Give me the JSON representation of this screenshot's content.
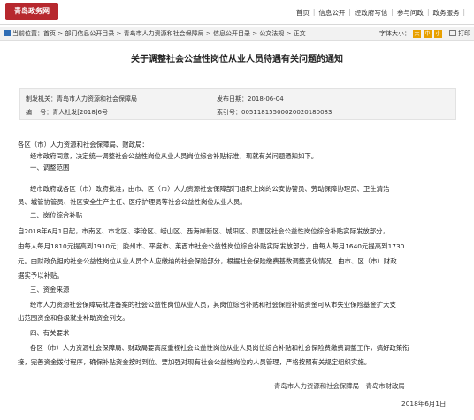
{
  "header": {
    "logo_text": "青岛政务网",
    "nav": [
      "首页",
      "信息公开",
      "经政府写信",
      "参与问政",
      "政务服务"
    ],
    "has_more": "| "
  },
  "breadcrumb": {
    "label": "当前位置：",
    "items": [
      "首页",
      "部门信息公开目录",
      "青岛市人力资源和社会保障局",
      "信息公开目录",
      "公文法规",
      "正文"
    ]
  },
  "tools": {
    "font_label": "字体大小：",
    "font_btns": [
      "大",
      "中",
      "小"
    ],
    "print_label": "打印"
  },
  "doc": {
    "title": "关于调整社会公益性岗位从业人员待遇有关问题的通知",
    "meta": {
      "issuer_label": "制发机关：",
      "issuer": "青岛市人力资源和社会保障局",
      "date_label": "发布日期：",
      "date": "2018-06-04",
      "number_label": "编　 号：",
      "number": "青人社发[2018]6号",
      "index_label": "索引号：",
      "index": "00511815500020020180083"
    },
    "lines": [
      "各区（市）人力资源和社会保障局、财政局：",
      "经市政府同意，决定统一调整社会公益性岗位从业人员岗位综合补贴标准，现就有关问题通知如下。",
      "一、调整范围",
      "经市政府或各区（市）政府批准，由市、区（市）人力资源社会保障部门组织上岗的公安协警员、劳动保障协理员、卫生清洁",
      "员、城管协管员、社区安全生产主任、医疗护理员等社会公益性岗位从业人员。",
      "二、岗位综合补贴",
      "自2018年6月1日起，市南区、市北区、李沧区、崂山区、西海岸新区、城阳区、即墨区社会公益性岗位综合补贴实际发放部分，",
      "由每人每月1810元提高到1910元；胶州市、平度市、莱西市社会公益性岗位综合补贴实际发放部分，由每人每月1640元提高到1730",
      "元。由财政负担的社会公益性岗位从业人员个人应缴纳的社会保险部分，根据社会保险缴费基数调整变化情况，由市、区（市）财政",
      "据实予以补贴。",
      "三、资金来源",
      "经市人力资源社会保障局批准备案的社会公益性岗位从业人员，其岗位综合补贴和社会保险补贴资金可从市失业保险基金扩大支",
      "出范围资金和各级就业补助资金列支。",
      "四、有关要求",
      "各区（市）人力资源社会保障局、财政局要高度重视社会公益性岗位从业人员岗位综合补贴和社会保险费缴费调整工作，搞好政策衔",
      "接，完善资金拨付程序，确保补贴资金按时到位。要加强对现有社会公益性岗位的人员管理，严格按照有关规定组织实施。"
    ],
    "signature": "青岛市人力资源和社会保障局　青岛市财政局",
    "sign_date": "2018年6月1日"
  }
}
